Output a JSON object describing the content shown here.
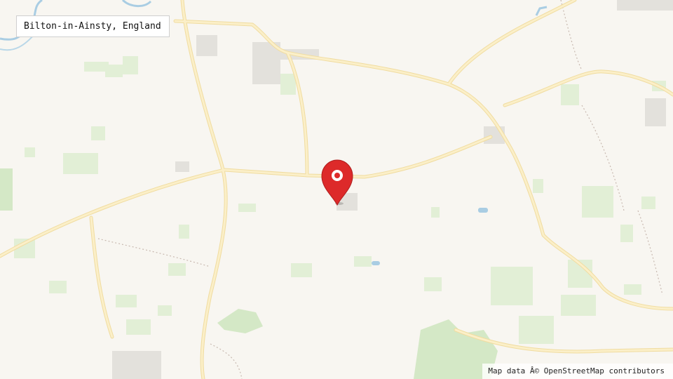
{
  "location": {
    "label": "Bilton-in-Ainsty, England"
  },
  "attribution": {
    "text": "Map data Â© OpenStreetMap contributors"
  },
  "marker": {
    "icon": "map-pin-icon",
    "color": "#dd2a2a"
  },
  "colors": {
    "land": "#f8f6f1",
    "field": "#e2efd6",
    "wood": "#d4e8c6",
    "road": "#fbefc8",
    "road_edge": "#f0dca0",
    "water": "#a9cde3",
    "building": "#e3e1dc"
  }
}
